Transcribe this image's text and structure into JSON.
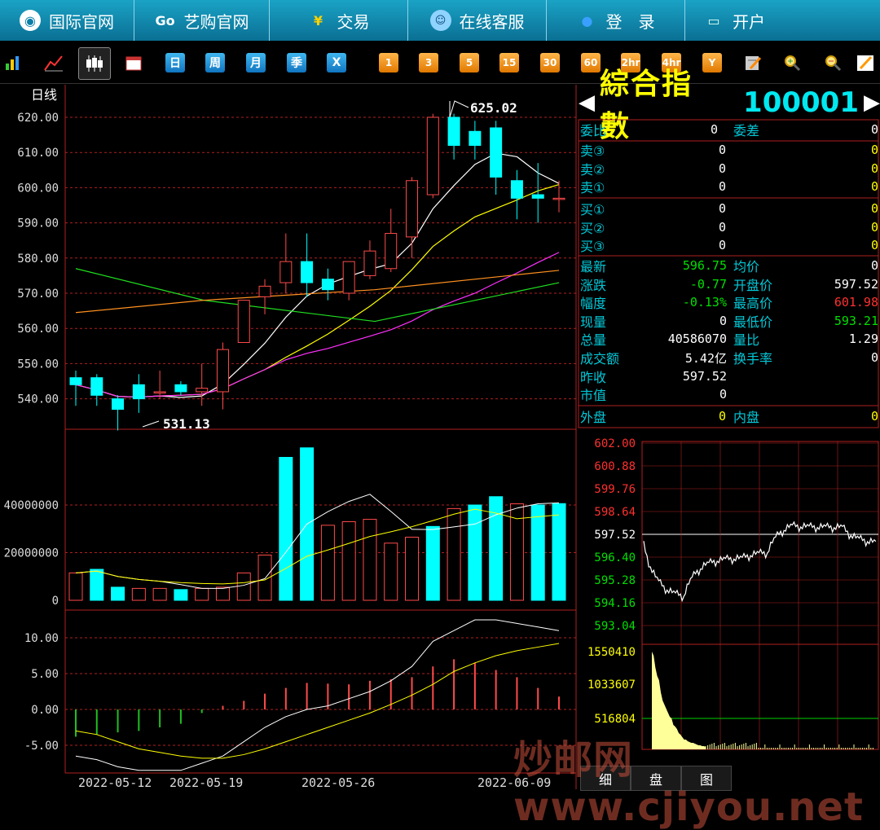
{
  "nav": [
    {
      "label": "国际官网",
      "icon": "globe-icon"
    },
    {
      "label": "艺购官网",
      "icon": "go-icon"
    },
    {
      "label": "交易",
      "icon": "yen-icon"
    },
    {
      "label": "在线客服",
      "icon": "chat-icon"
    },
    {
      "label": "登　录",
      "icon": "user-icon"
    },
    {
      "label": "开户",
      "icon": "monitor-icon"
    }
  ],
  "toolbar": {
    "periods": [
      "日",
      "周",
      "月",
      "季",
      "X"
    ],
    "minutes": [
      "1",
      "3",
      "5",
      "15",
      "30",
      "60",
      "2hr",
      "4hr",
      "Y"
    ]
  },
  "chart_title": "日线",
  "stock": {
    "name": "綜合指數",
    "code": "100001"
  },
  "orderbook": {
    "weibi_label": "委比",
    "weibi": "0",
    "weicha_label": "委差",
    "weicha": "0",
    "sells": [
      {
        "label": "卖③",
        "price": "0",
        "vol": "0"
      },
      {
        "label": "卖②",
        "price": "0",
        "vol": "0"
      },
      {
        "label": "卖①",
        "price": "0",
        "vol": "0"
      }
    ],
    "buys": [
      {
        "label": "买①",
        "price": "0",
        "vol": "0"
      },
      {
        "label": "买②",
        "price": "0",
        "vol": "0"
      },
      {
        "label": "买③",
        "price": "0",
        "vol": "0"
      }
    ]
  },
  "stats": [
    {
      "l": "最新",
      "v": "596.75",
      "l2": "均价",
      "v2": "0",
      "c": "#00e000",
      "c2": "#fff"
    },
    {
      "l": "涨跌",
      "v": "-0.77",
      "l2": "开盘价",
      "v2": "597.52",
      "c": "#00e000",
      "c2": "#fff"
    },
    {
      "l": "幅度",
      "v": "-0.13%",
      "l2": "最高价",
      "v2": "601.98",
      "c": "#00e000",
      "c2": "#ff3030"
    },
    {
      "l": "现量",
      "v": "0",
      "l2": "最低价",
      "v2": "593.21",
      "c": "#fff",
      "c2": "#00e000"
    },
    {
      "l": "总量",
      "v": "40586070",
      "l2": "量比",
      "v2": "1.29",
      "c": "#fff",
      "c2": "#fff"
    },
    {
      "l": "成交额",
      "v": "5.42亿",
      "l2": "换手率",
      "v2": "0",
      "c": "#fff",
      "c2": "#fff"
    },
    {
      "l": "昨收",
      "v": "597.52",
      "l2": "",
      "v2": "",
      "c": "#fff",
      "c2": "#fff"
    },
    {
      "l": "市值",
      "v": "0",
      "l2": "",
      "v2": "",
      "c": "#fff",
      "c2": "#fff"
    }
  ],
  "outer": {
    "l": "外盘",
    "v": "0",
    "l2": "内盘",
    "v2": "0"
  },
  "intraday": {
    "prices": [
      "602.00",
      "600.88",
      "599.76",
      "598.64",
      "597.52",
      "596.40",
      "595.28",
      "594.16",
      "593.04"
    ],
    "vol_labels": [
      "1550410",
      "1033607",
      "516804"
    ]
  },
  "bottom_tabs": [
    "细",
    "盘",
    "图"
  ],
  "watermark": "炒邮网 www.cjiyou.net",
  "chart_data": {
    "type": "candlestick",
    "title": "日线",
    "ylim": [
      531,
      625
    ],
    "yticks": [
      "620.00",
      "610.00",
      "600.00",
      "590.00",
      "580.00",
      "570.00",
      "560.00",
      "550.00",
      "540.00"
    ],
    "xticks": [
      "2022-05-12",
      "2022-05-19",
      "2022-05-26",
      "2022-06-09"
    ],
    "high_label": "625.02",
    "low_label": "531.13",
    "candles": [
      [
        546,
        548,
        538,
        544
      ],
      [
        546,
        547,
        538,
        541
      ],
      [
        540,
        541,
        531,
        537
      ],
      [
        544,
        547,
        536,
        540
      ],
      [
        542,
        548,
        540,
        542
      ],
      [
        544,
        545,
        541,
        542
      ],
      [
        542,
        550,
        538,
        543
      ],
      [
        542,
        556,
        537,
        554
      ],
      [
        556,
        568,
        556,
        568
      ],
      [
        569,
        574,
        564,
        572
      ],
      [
        573,
        587,
        570,
        579
      ],
      [
        579,
        587,
        569,
        573
      ],
      [
        574,
        577,
        568,
        571
      ],
      [
        570,
        579,
        568,
        579
      ],
      [
        575,
        585,
        574,
        582
      ],
      [
        577,
        594,
        576,
        587
      ],
      [
        586,
        603,
        580,
        602
      ],
      [
        598,
        621,
        597,
        620
      ],
      [
        620,
        621,
        608,
        612
      ],
      [
        616,
        619,
        608,
        612
      ],
      [
        617,
        619,
        598,
        603
      ],
      [
        602,
        605,
        591,
        597
      ],
      [
        598,
        607,
        590,
        597
      ],
      [
        597,
        602,
        593,
        597
      ]
    ],
    "volume": {
      "yticks": [
        "40000000",
        "20000000",
        "0"
      ],
      "bars": [
        11500000,
        13000000,
        5500000,
        5000000,
        5000000,
        4500000,
        5000000,
        5500000,
        11500000,
        19000000,
        60000000,
        64000000,
        31500000,
        33000000,
        34000000,
        24000000,
        26500000,
        31000000,
        38500000,
        40000000,
        43500000,
        40500000,
        40000000,
        40586070
      ],
      "up": [
        false,
        true,
        true,
        false,
        false,
        true,
        false,
        false,
        false,
        false,
        true,
        true,
        false,
        false,
        false,
        false,
        false,
        true,
        false,
        true,
        true,
        false,
        true,
        true
      ]
    },
    "macd": {
      "yticks": [
        "10.00",
        "5.00",
        "0.00",
        "-5.00"
      ],
      "hist": [
        -3.8,
        -3.5,
        -3.2,
        -3.0,
        -2.5,
        -2.0,
        -0.5,
        0.5,
        1.2,
        2.2,
        3.0,
        3.7,
        3.6,
        3.5,
        4.0,
        4.2,
        4.5,
        6.0,
        7.0,
        6.5,
        5.5,
        4.5,
        3.0,
        1.8
      ]
    }
  }
}
